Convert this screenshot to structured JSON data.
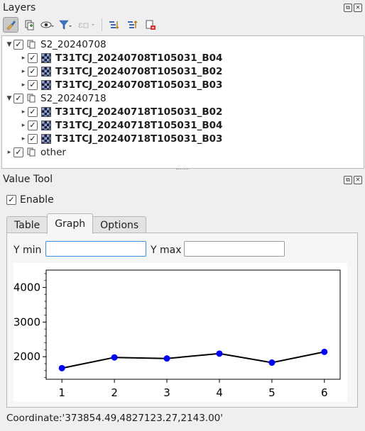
{
  "layers_panel": {
    "title": "Layers",
    "tree": [
      {
        "type": "group",
        "label": "S2_20240708",
        "expanded": true,
        "checked": true,
        "children": [
          {
            "label": "T31TCJ_20240708T105031_B04",
            "checked": true
          },
          {
            "label": "T31TCJ_20240708T105031_B02",
            "checked": true
          },
          {
            "label": "T31TCJ_20240708T105031_B03",
            "checked": true
          }
        ]
      },
      {
        "type": "group",
        "label": "S2_20240718",
        "expanded": true,
        "checked": true,
        "children": [
          {
            "label": "T31TCJ_20240718T105031_B02",
            "checked": true
          },
          {
            "label": "T31TCJ_20240718T105031_B04",
            "checked": true
          },
          {
            "label": "T31TCJ_20240718T105031_B03",
            "checked": true
          }
        ]
      },
      {
        "type": "group",
        "label": "other",
        "expanded": false,
        "checked": true,
        "children": []
      }
    ],
    "toolbar_icons": [
      "style-brush-icon",
      "add-group-icon",
      "visibility-eye-icon",
      "filter-icon",
      "expression-filter-icon",
      "expand-all-icon",
      "collapse-all-icon",
      "remove-layer-icon"
    ]
  },
  "value_tool": {
    "title": "Value Tool",
    "enable_label": "Enable",
    "enable_checked": true,
    "tabs": [
      "Table",
      "Graph",
      "Options"
    ],
    "active_tab": "Graph",
    "ymin_label": "Y min",
    "ymin_value": "",
    "ymax_label": "Y max",
    "ymax_value": "",
    "coordinate": "Coordinate:'373854.49,4827123.27,2143.00'"
  },
  "chart_data": {
    "type": "line",
    "x": [
      1,
      2,
      3,
      4,
      5,
      6
    ],
    "values": [
      1670,
      1980,
      1950,
      2090,
      1830,
      2140
    ],
    "xlim": [
      0.7,
      6.3
    ],
    "ylim": [
      1350,
      4500
    ],
    "yticks": [
      2000,
      3000,
      4000
    ],
    "ytick_labels": [
      "2000",
      "3000",
      "4000"
    ],
    "xticks": [
      1,
      2,
      3,
      4,
      5,
      6
    ],
    "xtick_labels": [
      "1",
      "2",
      "3",
      "4",
      "5",
      "6"
    ],
    "line_color": "#000000",
    "marker_color": "#0000ff",
    "grid": false
  }
}
